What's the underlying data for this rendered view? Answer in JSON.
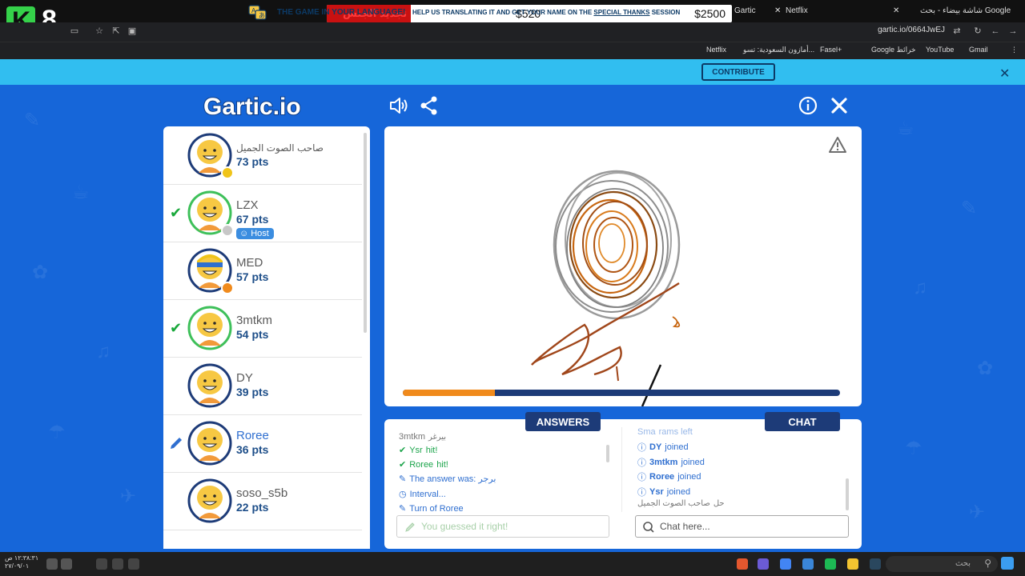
{
  "stream": {
    "badge_count": "8",
    "donation_label": "تجديد الجنس",
    "donation_current": "$520",
    "donation_goal": "$2500",
    "donation_progress": 0.208
  },
  "browser": {
    "tabs": [
      {
        "label": "Gartic"
      },
      {
        "label": "Netflix"
      },
      {
        "label": "شاشة بيضاء - بحث Google"
      }
    ],
    "url": "gartic.io/0664JwEJ",
    "bookmarks": [
      "Netflix",
      "أمازون السعودية: تسو...",
      "Fasel+",
      "Google خرائط",
      "YouTube",
      "Gmail"
    ]
  },
  "banner": {
    "title": "THE GAME IN YOUR LANGUAGE!",
    "text_before": "HELP US TRANSLATING IT AND GET YOUR NAME ON THE",
    "text_link": "SPECIAL THANKS",
    "text_after": "SESSION",
    "contribute_label": "CONTRIBUTE"
  },
  "game": {
    "logo_text": "Gartic.io",
    "timer_progress": 0.21,
    "players": [
      {
        "name": "صاحب الصوت الجميل",
        "points": "73 pts",
        "checked": false,
        "drawing": false,
        "host": false
      },
      {
        "name": "LZX",
        "points": "67 pts",
        "checked": true,
        "drawing": false,
        "host": true
      },
      {
        "name": "MED",
        "points": "57 pts",
        "checked": false,
        "drawing": false,
        "host": false
      },
      {
        "name": "3mtkm",
        "points": "54 pts",
        "checked": true,
        "drawing": false,
        "host": false
      },
      {
        "name": "DY",
        "points": "39 pts",
        "checked": false,
        "drawing": false,
        "host": false
      },
      {
        "name": "Roree",
        "points": "36 pts",
        "checked": false,
        "drawing": true,
        "host": false
      },
      {
        "name": "soso_s5b",
        "points": "22 pts",
        "checked": false,
        "drawing": false,
        "host": false
      }
    ],
    "host_label": "Host",
    "answers_title": "ANSWERS",
    "chat_title": "CHAT",
    "answers": [
      {
        "type": "plain",
        "who": "3mtkm",
        "text": "بيرغر"
      },
      {
        "type": "hit",
        "who": "Ysr",
        "text": "hit!"
      },
      {
        "type": "hit",
        "who": "Roree",
        "text": "hit!"
      },
      {
        "type": "answer",
        "who": "",
        "text": "The answer was: برجر"
      },
      {
        "type": "interval",
        "who": "",
        "text": "Interval..."
      },
      {
        "type": "turn",
        "who": "",
        "text": "Turn of Roree"
      }
    ],
    "chat": [
      {
        "who": "Sma",
        "text": "rams left"
      },
      {
        "who": "DY",
        "text": "joined"
      },
      {
        "who": "3mtkm",
        "text": "joined"
      },
      {
        "who": "Roree",
        "text": "joined"
      },
      {
        "who": "Ysr",
        "text": "joined"
      },
      {
        "who": "صاحب الصوت الجميل",
        "text": "حل"
      }
    ],
    "answer_placeholder": "You guessed it right!",
    "chat_placeholder": "Chat here..."
  },
  "taskbar": {
    "clock_line1": "١٢:٣٨:٣١ ص",
    "clock_line2": "٢٧/٠٩/٠١",
    "search_label": "بحث"
  }
}
